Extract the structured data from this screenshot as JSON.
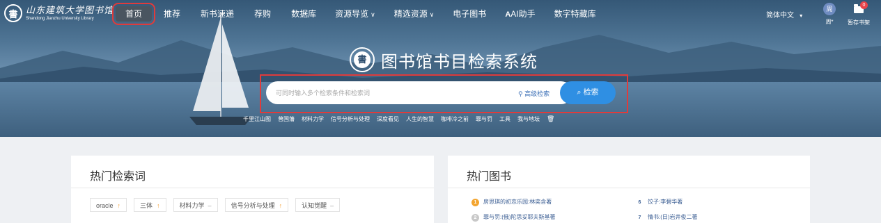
{
  "app": {
    "logo_cn": "山东建筑大学图书馆",
    "logo_en": "Shandong Jianzhu University Library",
    "title": "图书馆书目检索系统"
  },
  "nav": {
    "items": [
      {
        "label": "首页",
        "active": true
      },
      {
        "label": "推荐"
      },
      {
        "label": "新书速递"
      },
      {
        "label": "荐购"
      },
      {
        "label": "数据库"
      },
      {
        "label": "资源导览",
        "dropdown": true
      },
      {
        "label": "精选资源",
        "dropdown": true
      },
      {
        "label": "电子图书"
      },
      {
        "label": "AI助手"
      },
      {
        "label": "数字特藏库"
      }
    ],
    "language": "简体中文",
    "user_avatar": "周",
    "user_name": "周*",
    "shelf_label": "暂存书架",
    "shelf_count": "0"
  },
  "search": {
    "placeholder": "可同时输入多个检索条件和检索词",
    "advanced_label": "高级检索",
    "button_label": "检索"
  },
  "hot_words": [
    "千里江山图",
    "曾国藩",
    "材料力学",
    "信号分析与处理",
    "深度看见",
    "人生的智慧",
    "咖啡冷之前",
    "罪与罚",
    "工具",
    "我与地坛"
  ],
  "hot_search": {
    "title": "热门检索词",
    "tags": [
      {
        "label": "oracle",
        "trend": "up"
      },
      {
        "label": "三体",
        "trend": "up"
      },
      {
        "label": "材料力学",
        "trend": "flat"
      },
      {
        "label": "信号分析与处理",
        "trend": "up"
      },
      {
        "label": "认知觉醒",
        "trend": "flat"
      }
    ]
  },
  "hot_books": {
    "title": "热门图书",
    "items": [
      {
        "rank": "1",
        "text": "房思琪的初恋乐园:林奕含著"
      },
      {
        "rank": "2",
        "text": "罪与罚:(俄)陀思妥耶夫斯基著"
      },
      {
        "rank": "6",
        "text": "饺子:李碧华著"
      },
      {
        "rank": "7",
        "text": "情书:(日)岩井俊二著"
      }
    ]
  },
  "colors": {
    "accent": "#2f8fe3",
    "highlight_frame": "#e03b3b",
    "trend_up": "#f39b2c"
  }
}
